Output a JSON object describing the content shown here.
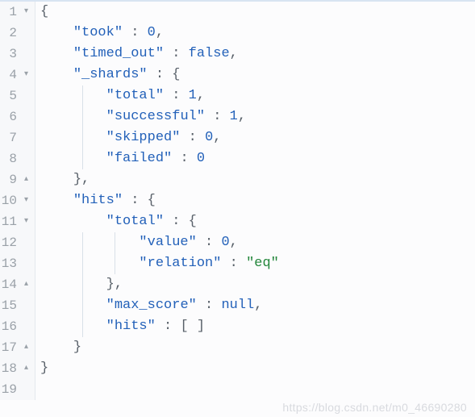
{
  "watermark": "https://blog.csdn.net/m0_46690280",
  "lines": [
    {
      "num": "1",
      "fold": "▾",
      "indentGuides": [],
      "tokens": [
        {
          "cls": "punct",
          "t": "{"
        }
      ]
    },
    {
      "num": "2",
      "fold": "",
      "indentGuides": [],
      "tokens": [
        {
          "cls": "",
          "t": "    "
        },
        {
          "cls": "key",
          "t": "\"took\""
        },
        {
          "cls": "punct",
          "t": " : "
        },
        {
          "cls": "num",
          "t": "0"
        },
        {
          "cls": "punct",
          "t": ","
        }
      ]
    },
    {
      "num": "3",
      "fold": "",
      "indentGuides": [],
      "tokens": [
        {
          "cls": "",
          "t": "    "
        },
        {
          "cls": "key",
          "t": "\"timed_out\""
        },
        {
          "cls": "punct",
          "t": " : "
        },
        {
          "cls": "kw",
          "t": "false"
        },
        {
          "cls": "punct",
          "t": ","
        }
      ]
    },
    {
      "num": "4",
      "fold": "▾",
      "indentGuides": [],
      "tokens": [
        {
          "cls": "",
          "t": "    "
        },
        {
          "cls": "key",
          "t": "\"_shards\""
        },
        {
          "cls": "punct",
          "t": " : {"
        }
      ]
    },
    {
      "num": "5",
      "fold": "",
      "indentGuides": [
        58
      ],
      "tokens": [
        {
          "cls": "",
          "t": "        "
        },
        {
          "cls": "key",
          "t": "\"total\""
        },
        {
          "cls": "punct",
          "t": " : "
        },
        {
          "cls": "num",
          "t": "1"
        },
        {
          "cls": "punct",
          "t": ","
        }
      ]
    },
    {
      "num": "6",
      "fold": "",
      "indentGuides": [
        58
      ],
      "tokens": [
        {
          "cls": "",
          "t": "        "
        },
        {
          "cls": "key",
          "t": "\"successful\""
        },
        {
          "cls": "punct",
          "t": " : "
        },
        {
          "cls": "num",
          "t": "1"
        },
        {
          "cls": "punct",
          "t": ","
        }
      ]
    },
    {
      "num": "7",
      "fold": "",
      "indentGuides": [
        58
      ],
      "tokens": [
        {
          "cls": "",
          "t": "        "
        },
        {
          "cls": "key",
          "t": "\"skipped\""
        },
        {
          "cls": "punct",
          "t": " : "
        },
        {
          "cls": "num",
          "t": "0"
        },
        {
          "cls": "punct",
          "t": ","
        }
      ]
    },
    {
      "num": "8",
      "fold": "",
      "indentGuides": [
        58
      ],
      "tokens": [
        {
          "cls": "",
          "t": "        "
        },
        {
          "cls": "key",
          "t": "\"failed\""
        },
        {
          "cls": "punct",
          "t": " : "
        },
        {
          "cls": "num",
          "t": "0"
        }
      ]
    },
    {
      "num": "9",
      "fold": "▴",
      "indentGuides": [],
      "tokens": [
        {
          "cls": "",
          "t": "    "
        },
        {
          "cls": "punct",
          "t": "},"
        }
      ]
    },
    {
      "num": "10",
      "fold": "▾",
      "indentGuides": [],
      "tokens": [
        {
          "cls": "",
          "t": "    "
        },
        {
          "cls": "key",
          "t": "\"hits\""
        },
        {
          "cls": "punct",
          "t": " : {"
        }
      ]
    },
    {
      "num": "11",
      "fold": "▾",
      "indentGuides": [],
      "tokens": [
        {
          "cls": "",
          "t": "        "
        },
        {
          "cls": "key",
          "t": "\"total\""
        },
        {
          "cls": "punct",
          "t": " : {"
        }
      ]
    },
    {
      "num": "12",
      "fold": "",
      "indentGuides": [
        58,
        98
      ],
      "tokens": [
        {
          "cls": "",
          "t": "            "
        },
        {
          "cls": "key",
          "t": "\"value\""
        },
        {
          "cls": "punct",
          "t": " : "
        },
        {
          "cls": "num",
          "t": "0"
        },
        {
          "cls": "punct",
          "t": ","
        }
      ]
    },
    {
      "num": "13",
      "fold": "",
      "indentGuides": [
        58,
        98
      ],
      "tokens": [
        {
          "cls": "",
          "t": "            "
        },
        {
          "cls": "key",
          "t": "\"relation\""
        },
        {
          "cls": "punct",
          "t": " : "
        },
        {
          "cls": "str",
          "t": "\"eq\""
        }
      ]
    },
    {
      "num": "14",
      "fold": "▴",
      "indentGuides": [
        58
      ],
      "tokens": [
        {
          "cls": "",
          "t": "        "
        },
        {
          "cls": "punct",
          "t": "},"
        }
      ]
    },
    {
      "num": "15",
      "fold": "",
      "indentGuides": [
        58
      ],
      "tokens": [
        {
          "cls": "",
          "t": "        "
        },
        {
          "cls": "key",
          "t": "\"max_score\""
        },
        {
          "cls": "punct",
          "t": " : "
        },
        {
          "cls": "kw",
          "t": "null"
        },
        {
          "cls": "punct",
          "t": ","
        }
      ]
    },
    {
      "num": "16",
      "fold": "",
      "indentGuides": [
        58
      ],
      "tokens": [
        {
          "cls": "",
          "t": "        "
        },
        {
          "cls": "key",
          "t": "\"hits\""
        },
        {
          "cls": "punct",
          "t": " : [ ]"
        }
      ]
    },
    {
      "num": "17",
      "fold": "▴",
      "indentGuides": [],
      "tokens": [
        {
          "cls": "",
          "t": "    "
        },
        {
          "cls": "punct",
          "t": "}"
        }
      ]
    },
    {
      "num": "18",
      "fold": "▴",
      "indentGuides": [],
      "tokens": [
        {
          "cls": "punct",
          "t": "}"
        }
      ]
    },
    {
      "num": "19",
      "fold": "",
      "indentGuides": [],
      "tokens": []
    }
  ]
}
